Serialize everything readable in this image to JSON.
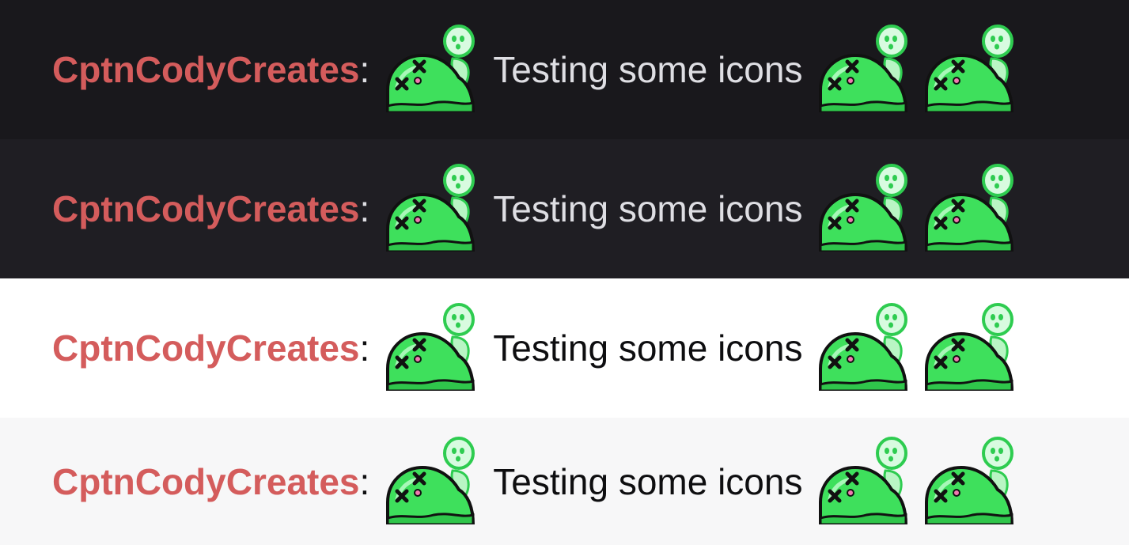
{
  "colors": {
    "username": "#d45c5c",
    "emote_body": "#3ee05c",
    "emote_ghost": "#b9f5c4",
    "emote_outline": "#111111"
  },
  "emote": {
    "icon": "dead-slime-ghost-icon"
  },
  "rows": [
    {
      "theme": "dark",
      "background": "#19181c",
      "text_color": "#dedee3",
      "username": "CptnCodyCreates",
      "colon": ":",
      "message": "Testing some icons"
    },
    {
      "theme": "dark-alt",
      "background": "#1f1e23",
      "text_color": "#dedee3",
      "username": "CptnCodyCreates",
      "colon": ":",
      "message": "Testing some icons"
    },
    {
      "theme": "light",
      "background": "#ffffff",
      "text_color": "#0e0e10",
      "username": "CptnCodyCreates",
      "colon": ":",
      "message": "Testing some icons"
    },
    {
      "theme": "light-alt",
      "background": "#f7f7f8",
      "text_color": "#0e0e10",
      "username": "CptnCodyCreates",
      "colon": ":",
      "message": "Testing some icons"
    }
  ]
}
